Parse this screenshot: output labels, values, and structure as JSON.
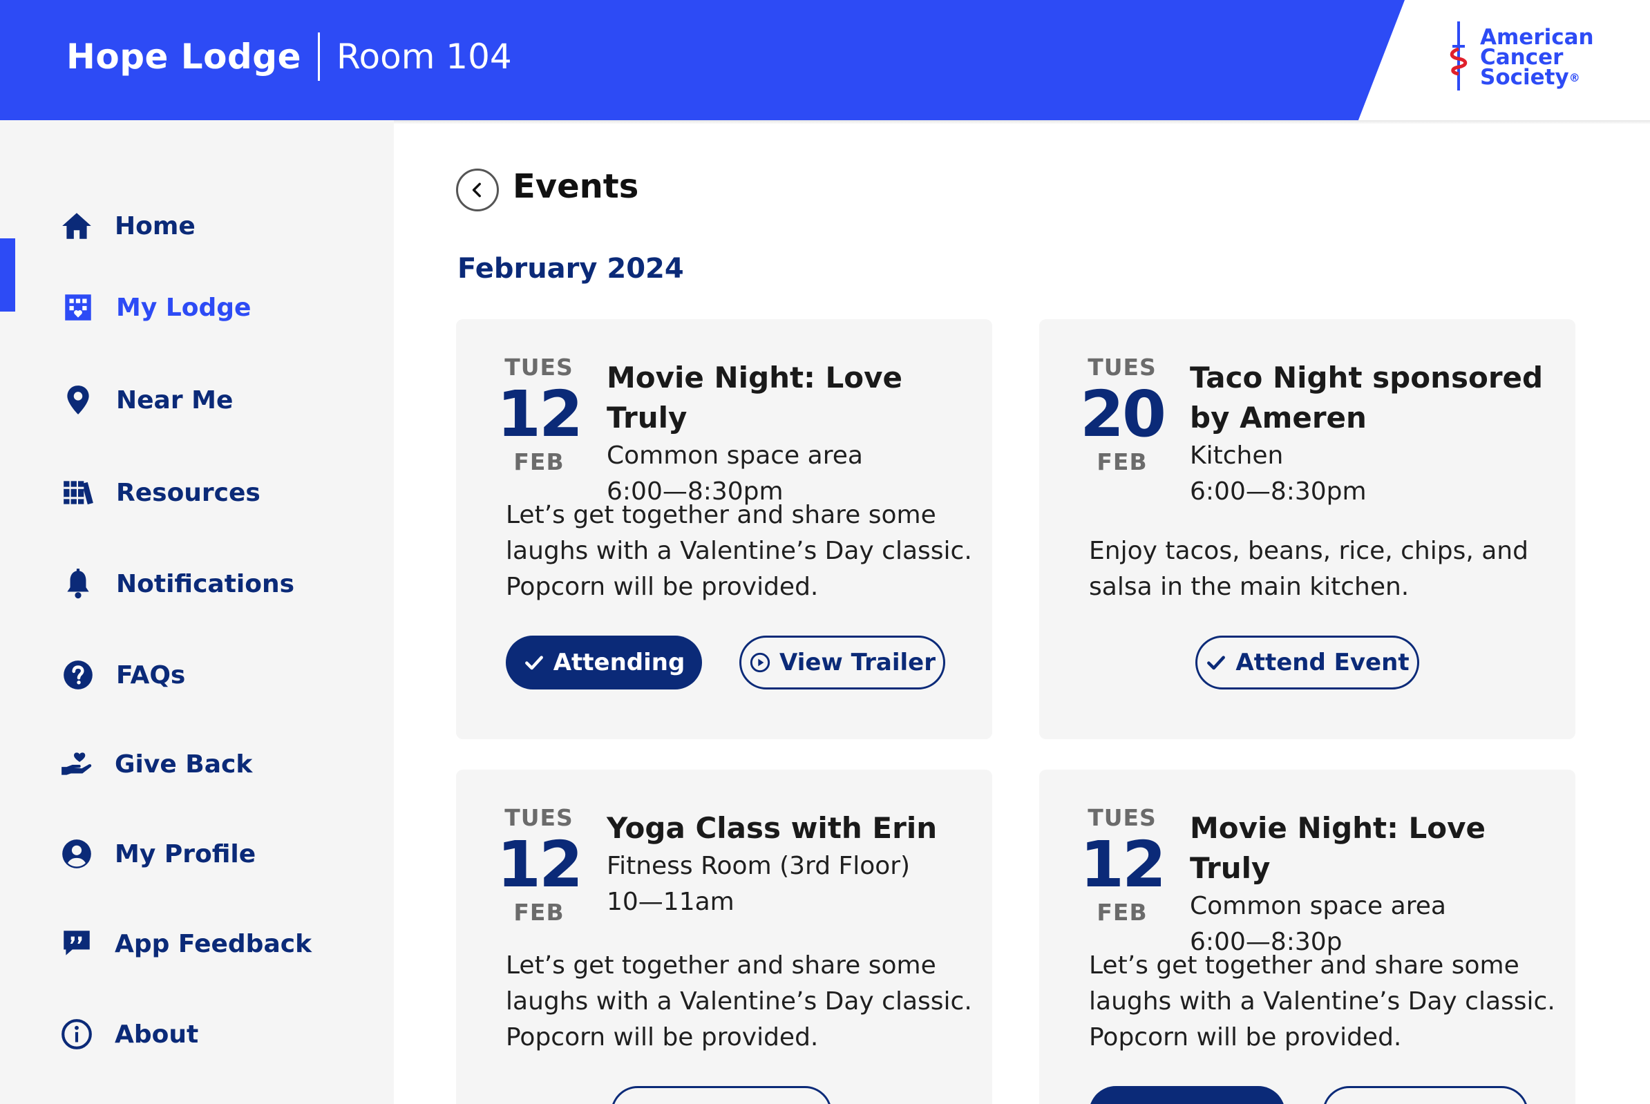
{
  "header": {
    "lodge_name": "Hope Lodge",
    "room": "Room 104",
    "logo_text": [
      "American",
      "Cancer",
      "Society"
    ],
    "logo_trademark": "®"
  },
  "sidebar": {
    "items": [
      {
        "label": "Home",
        "icon": "home-icon"
      },
      {
        "label": "My Lodge",
        "icon": "lodge-icon",
        "active": true
      },
      {
        "label": "Near Me",
        "icon": "location-pin-icon"
      },
      {
        "label": "Resources",
        "icon": "resources-icon"
      },
      {
        "label": "Notifications",
        "icon": "bell-icon"
      },
      {
        "label": "FAQs",
        "icon": "question-icon"
      },
      {
        "label": "Give Back",
        "icon": "giving-hand-icon"
      },
      {
        "label": "My Profile",
        "icon": "user-circle-icon"
      },
      {
        "label": "App Feedback",
        "icon": "feedback-icon"
      },
      {
        "label": "About",
        "icon": "info-icon"
      }
    ]
  },
  "main": {
    "title": "Events",
    "month": "February 2024",
    "events": [
      {
        "dow": "TUES",
        "day": "12",
        "month": "FEB",
        "title": "Movie Night: Love Truly",
        "location": "Common space area",
        "time": "6:00—8:30pm",
        "description": "Let’s get together and share some laughs with a Valentine’s Day classic. Popcorn will be provided.",
        "buttons": [
          {
            "label": "Attending",
            "style": "solid",
            "icon": "check-icon"
          },
          {
            "label": "View Trailer",
            "style": "outline",
            "icon": "play-circle-icon"
          }
        ]
      },
      {
        "dow": "TUES",
        "day": "20",
        "month": "FEB",
        "title": "Taco Night sponsored by Ameren",
        "location": "Kitchen",
        "time": "6:00—8:30pm",
        "description": "Enjoy tacos, beans, rice, chips, and salsa in the main kitchen.",
        "buttons": [
          {
            "label": "Attend Event",
            "style": "outline",
            "icon": "check-icon"
          }
        ]
      },
      {
        "dow": "TUES",
        "day": "12",
        "month": "FEB",
        "title": "Yoga Class with Erin",
        "location": "Fitness Room (3rd Floor)",
        "time": "10—11am",
        "description": "Let’s get together and share some laughs with a Valentine’s Day classic. Popcorn will be provided."
      },
      {
        "dow": "TUES",
        "day": "12",
        "month": "FEB",
        "title": "Movie Night: Love Truly",
        "location": "Common space area",
        "time": "6:00—8:30p",
        "description": "Let’s get together and share some laughs with a Valentine’s Day classic. Popcorn will be provided."
      }
    ]
  },
  "colors": {
    "brand_blue": "#2d4bf5",
    "navy": "#0b2a78",
    "sidebar_bg": "#f5f5f5",
    "card_bg": "#f5f5f5"
  }
}
